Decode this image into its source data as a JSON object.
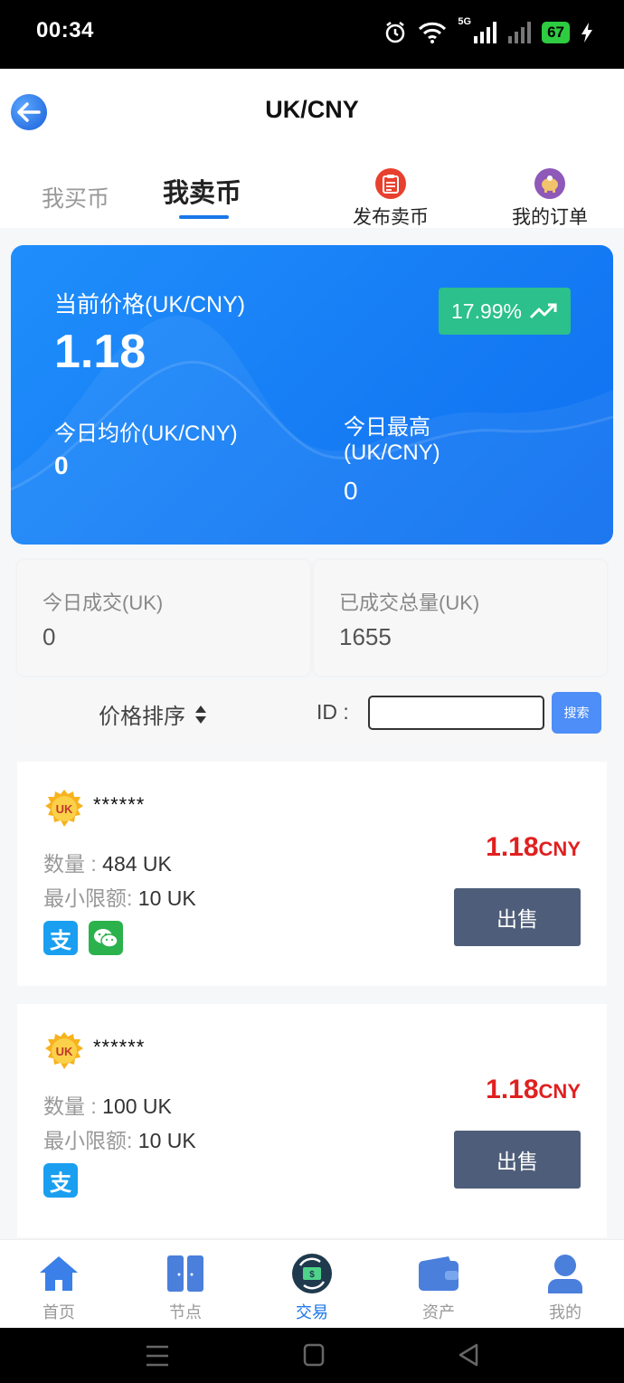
{
  "status_bar": {
    "time": "00:34",
    "battery": "67",
    "network": "5G"
  },
  "header": {
    "title": "UK/CNY"
  },
  "tabs": {
    "buy": "我买币",
    "sell": "我卖币"
  },
  "actions": {
    "publish": "发布卖币",
    "orders": "我的订单"
  },
  "price_card": {
    "current_label": "当前价格(UK/CNY)",
    "current_value": "1.18",
    "change": "17.99%",
    "avg_label": "今日均价(UK/CNY)",
    "avg_value": "0",
    "high_label": "今日最高(UK/CNY)",
    "high_value": "0"
  },
  "stats": {
    "today_label": "今日成交(UK)",
    "today_value": "0",
    "total_label": "已成交总量(UK)",
    "total_value": "1655"
  },
  "filter": {
    "sort_label": "价格排序",
    "id_label": "ID :",
    "id_placeholder": "",
    "search_label": "搜索"
  },
  "listings": [
    {
      "seller": "******",
      "qty_label": "数量 : ",
      "qty_value": "484 UK",
      "min_label": "最小限额: ",
      "min_value": "10 UK",
      "price": "1.18",
      "currency": "CNY",
      "sell_label": "出售",
      "payments": [
        "alipay",
        "wechat"
      ]
    },
    {
      "seller": "******",
      "qty_label": "数量 : ",
      "qty_value": "100 UK",
      "min_label": "最小限额: ",
      "min_value": "10 UK",
      "price": "1.18",
      "currency": "CNY",
      "sell_label": "出售",
      "payments": [
        "alipay"
      ]
    }
  ],
  "logo_text": "UK",
  "bottom_nav": [
    {
      "label": "首页",
      "icon": "home-icon"
    },
    {
      "label": "节点",
      "icon": "node-icon"
    },
    {
      "label": "交易",
      "icon": "trade-icon"
    },
    {
      "label": "资产",
      "icon": "wallet-icon"
    },
    {
      "label": "我的",
      "icon": "user-icon"
    }
  ],
  "colors": {
    "accent": "#1976e8",
    "price_red": "#e02020",
    "badge_green": "#2bc08c",
    "sell_button": "#4e5d79"
  }
}
